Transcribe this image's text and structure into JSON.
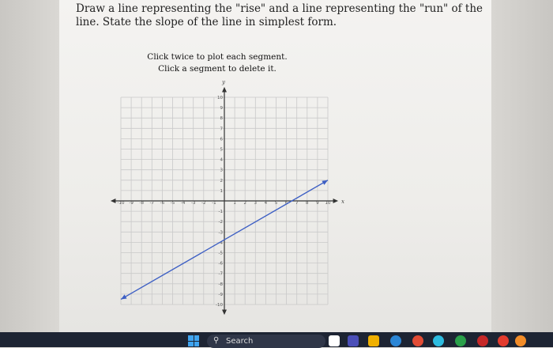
{
  "question": {
    "text": "Draw a line representing the \"rise\" and a line representing the \"run\" of the line. State the slope of the line in simplest form."
  },
  "instructions": {
    "line1": "Click twice to plot each segment.",
    "line2": "Click a segment to delete it."
  },
  "graph": {
    "x_axis_label": "x",
    "y_axis_label": "y",
    "x_range": [
      -10,
      10
    ],
    "y_range": [
      -10,
      10
    ],
    "x_tick_labels": [
      "-10",
      "-9",
      "-8",
      "-7",
      "-6",
      "-5",
      "-4",
      "-3",
      "-2",
      "-1",
      "1",
      "2",
      "3",
      "4",
      "5",
      "6",
      "7",
      "8",
      "9",
      "10"
    ],
    "y_tick_labels": [
      "10",
      "9",
      "8",
      "7",
      "6",
      "5",
      "4",
      "3",
      "2",
      "1",
      "-1",
      "-2",
      "-3",
      "-4",
      "-5",
      "-6",
      "-7",
      "-8",
      "-9",
      "-10"
    ],
    "line_color": "#3d5fc4",
    "line_points": [
      [
        -10,
        -9.5
      ],
      [
        10,
        2
      ]
    ]
  },
  "taskbar": {
    "search_label": "Search",
    "icon_colors": [
      "#ffffff",
      "#4b4fb8",
      "#f0b000",
      "#2b86d6",
      "#e24c35",
      "#2dbce0",
      "#2aa04a",
      "#c62828",
      "#e33b2e",
      "#f28c28"
    ]
  }
}
